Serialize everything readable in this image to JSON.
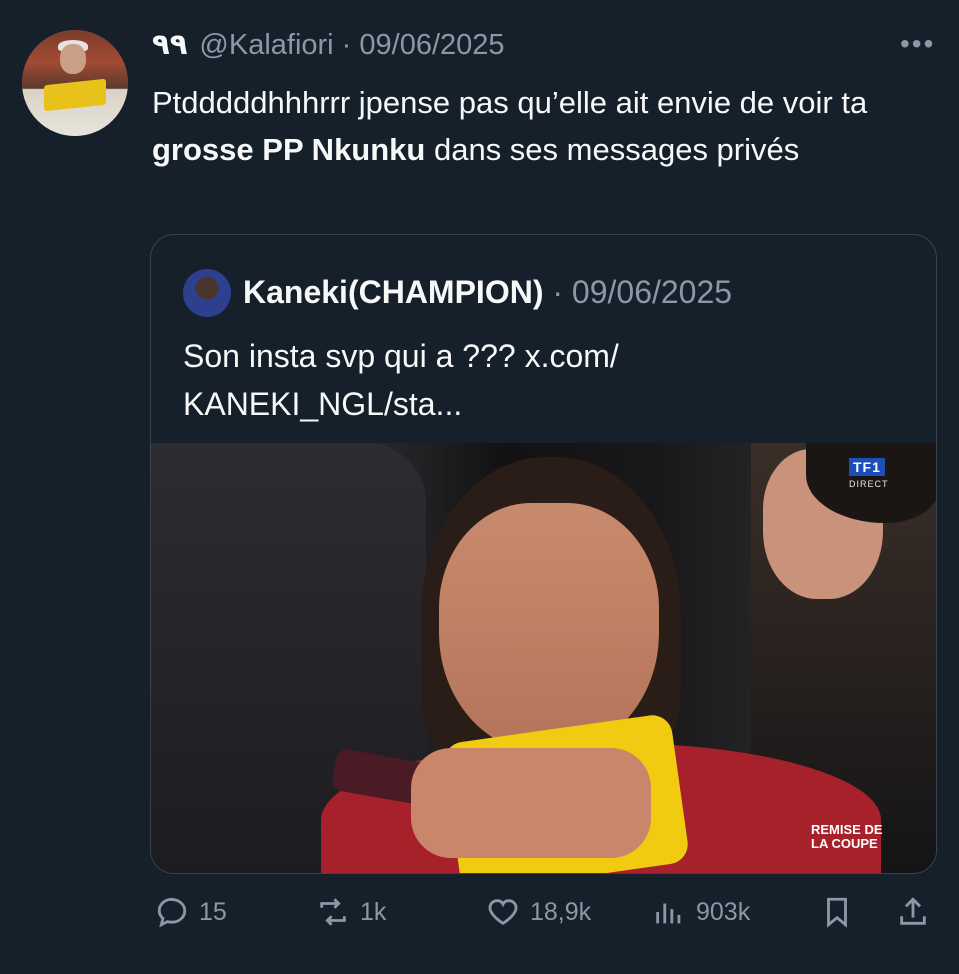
{
  "tweet": {
    "display_name": "٩٩",
    "handle_meta": "@Kalafiori · 09/06/2025",
    "text_before": "Ptdddddhhhrrr jpense pas qu’elle ait envie de voir ta ",
    "text_bold": "grosse PP Nkunku",
    "text_after": " dans ses messages privés",
    "more_label": "•••"
  },
  "quote": {
    "display_name": "Kaneki(CHAMPION)",
    "date_meta": " · 09/06/2025",
    "text": "Son insta svp qui a ??? x.com/ KANEKI_NGL/sta...",
    "image": {
      "broadcaster": "TF1",
      "broadcaster_tag": "DIRECT",
      "overlay_line1": "REMISE DE",
      "overlay_line2": "LA COUPE"
    }
  },
  "actions": {
    "replies": "15",
    "reposts": "1k",
    "likes": "18,9k",
    "views": "903k"
  },
  "icons": {
    "reply": "reply-icon",
    "repost": "repost-icon",
    "like": "like-icon",
    "views": "views-icon",
    "bookmark": "bookmark-icon",
    "share": "share-icon",
    "more": "more-icon"
  },
  "colors": {
    "background": "#15202b",
    "text": "#f7f9f9",
    "secondary": "#8b98a5",
    "border": "#38444d"
  }
}
